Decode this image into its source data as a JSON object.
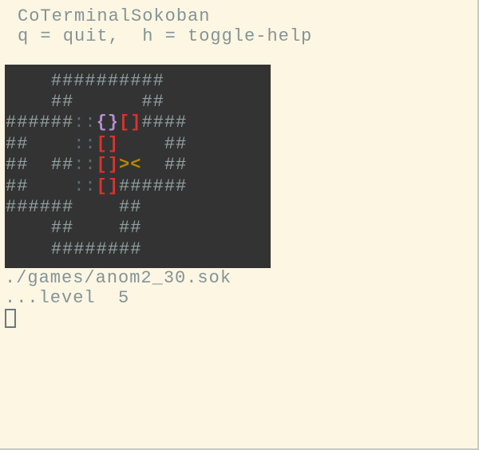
{
  "header": {
    "title": "CoTerminalSokoban",
    "help_line": "q = quit,  h = toggle-help"
  },
  "colors": {
    "bg": "#fdf6e3",
    "game_bg": "#333333",
    "wall": "#93a1a1",
    "goal": "#586e75",
    "box": "#dc322f",
    "box_on_goal": "#b58fcf",
    "pusher": "#b58900",
    "text": "#839496"
  },
  "board": {
    "rows": [
      [
        {
          "t": "    ",
          "c": "wall"
        },
        {
          "t": "##########",
          "c": "wall"
        }
      ],
      [
        {
          "t": "    ",
          "c": "wall"
        },
        {
          "t": "##",
          "c": "wall"
        },
        {
          "t": "      ",
          "c": "wall"
        },
        {
          "t": "##",
          "c": "wall"
        }
      ],
      [
        {
          "t": "######",
          "c": "wall"
        },
        {
          "t": "::",
          "c": "goal"
        },
        {
          "t": "{}",
          "c": "boxg"
        },
        {
          "t": "[]",
          "c": "box"
        },
        {
          "t": "####",
          "c": "wall"
        }
      ],
      [
        {
          "t": "##",
          "c": "wall"
        },
        {
          "t": "    ",
          "c": "wall"
        },
        {
          "t": "::",
          "c": "goal"
        },
        {
          "t": "[]",
          "c": "box"
        },
        {
          "t": "    ",
          "c": "wall"
        },
        {
          "t": "##",
          "c": "wall"
        }
      ],
      [
        {
          "t": "##",
          "c": "wall"
        },
        {
          "t": "  ",
          "c": "wall"
        },
        {
          "t": "##",
          "c": "wall"
        },
        {
          "t": "::",
          "c": "goal"
        },
        {
          "t": "[]",
          "c": "box"
        },
        {
          "t": "><",
          "c": "pusher"
        },
        {
          "t": "  ",
          "c": "wall"
        },
        {
          "t": "##",
          "c": "wall"
        }
      ],
      [
        {
          "t": "##",
          "c": "wall"
        },
        {
          "t": "    ",
          "c": "wall"
        },
        {
          "t": "::",
          "c": "goal"
        },
        {
          "t": "[]",
          "c": "box"
        },
        {
          "t": "######",
          "c": "wall"
        }
      ],
      [
        {
          "t": "######",
          "c": "wall"
        },
        {
          "t": "    ",
          "c": "wall"
        },
        {
          "t": "##",
          "c": "wall"
        }
      ],
      [
        {
          "t": "    ",
          "c": "wall"
        },
        {
          "t": "##",
          "c": "wall"
        },
        {
          "t": "    ",
          "c": "wall"
        },
        {
          "t": "##",
          "c": "wall"
        }
      ],
      [
        {
          "t": "    ",
          "c": "wall"
        },
        {
          "t": "########",
          "c": "wall"
        }
      ]
    ]
  },
  "status": {
    "file": "./games/anom2_30.sok",
    "level_line": "...level  5"
  }
}
